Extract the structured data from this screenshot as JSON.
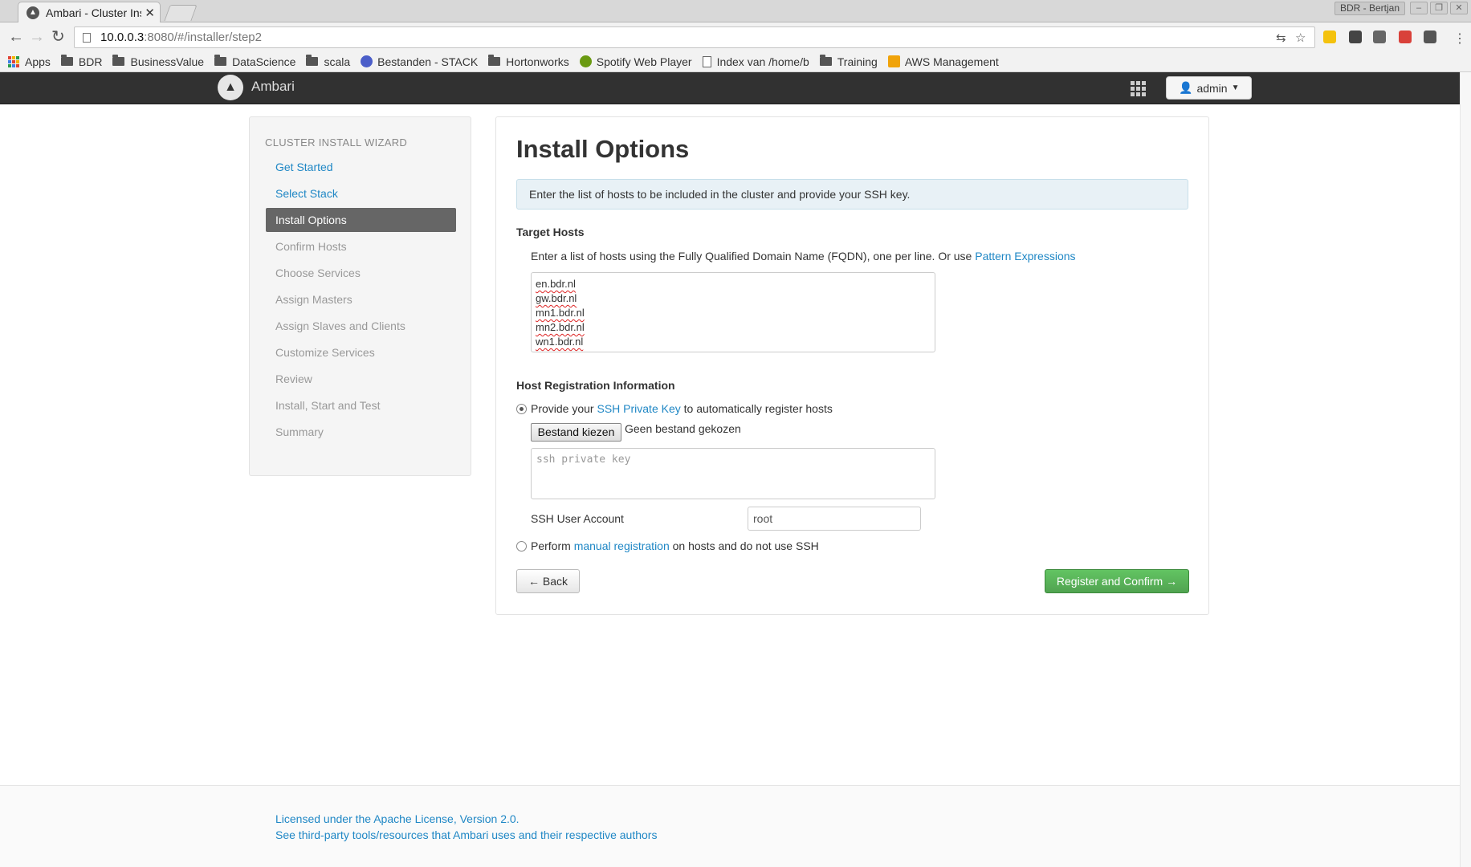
{
  "browser": {
    "tab_title": "Ambari - Cluster Instal",
    "profile": "BDR - Bertjan",
    "url_host": "10.0.0.3",
    "url_path": ":8080/#/installer/step2",
    "bookmarks": [
      "Apps",
      "BDR",
      "BusinessValue",
      "DataScience",
      "scala",
      "Bestanden - STACK",
      "Hortonworks",
      "Spotify Web Player",
      "Index van /home/b",
      "Training",
      "AWS Management"
    ]
  },
  "app": {
    "brand": "Ambari",
    "user": "admin"
  },
  "wizard": {
    "heading": "CLUSTER INSTALL WIZARD",
    "steps": [
      "Get Started",
      "Select Stack",
      "Install Options",
      "Confirm Hosts",
      "Choose Services",
      "Assign Masters",
      "Assign Slaves and Clients",
      "Customize Services",
      "Review",
      "Install, Start and Test",
      "Summary"
    ]
  },
  "main": {
    "title": "Install Options",
    "info": "Enter the list of hosts to be included in the cluster and provide your SSH key.",
    "target_hosts_title": "Target Hosts",
    "hint_text": "Enter a list of hosts using the Fully Qualified Domain Name (FQDN), one per line. Or use",
    "hint_link": "Pattern Expressions",
    "hosts": [
      "en.bdr.nl",
      "gw.bdr.nl",
      "mn1.bdr.nl",
      "mn2.bdr.nl",
      "wn1.bdr.nl"
    ],
    "host_reg_title": "Host Registration Information",
    "opt1_prefix": "Provide your",
    "opt1_link": "SSH Private Key",
    "opt1_suffix": "to automatically register hosts",
    "file_button": "Bestand kiezen",
    "file_status": "Geen bestand gekozen",
    "key_placeholder": "ssh private key",
    "ssh_user_label": "SSH User Account",
    "ssh_user_value": "root",
    "opt2_prefix": "Perform",
    "opt2_link": "manual registration",
    "opt2_suffix": "on hosts and do not use SSH",
    "back_button": "← Back",
    "next_button": "Register and Confirm →"
  },
  "footer": {
    "license": "Licensed under the Apache License, Version 2.0.",
    "third_party": "See third-party tools/resources that Ambari uses and their respective authors"
  },
  "colors": {
    "link": "#1f87c5",
    "navbar": "#313131",
    "active_step": "#666666",
    "primary_button": "#51a351",
    "info_bg": "#e8f1f6"
  }
}
